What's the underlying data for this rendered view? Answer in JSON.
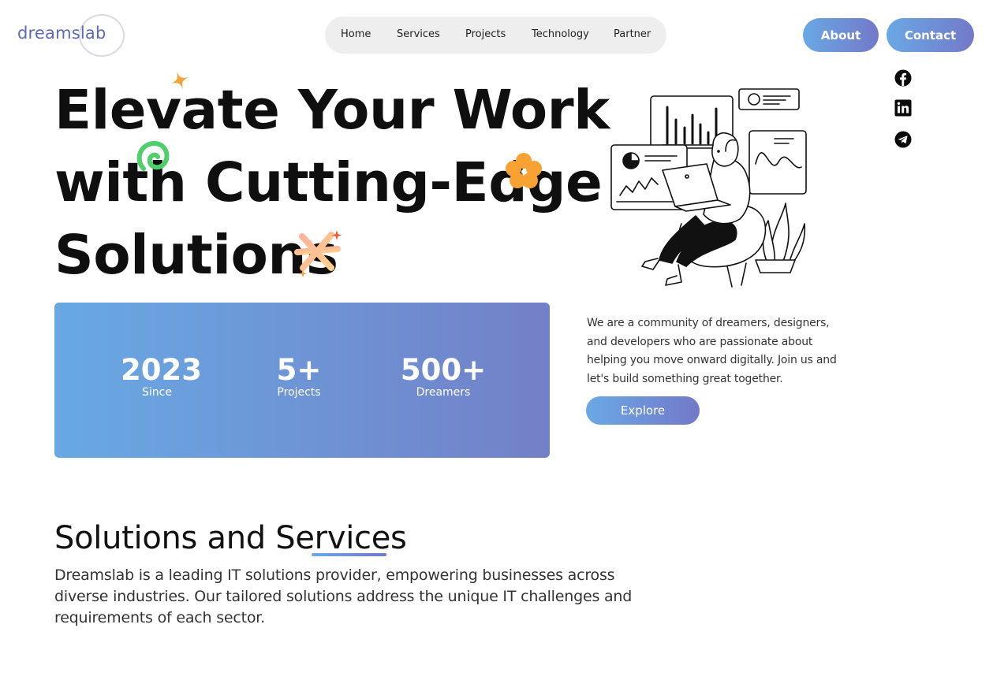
{
  "brand": {
    "logo_text": "dreamslab"
  },
  "nav": {
    "items": [
      {
        "label": "Home"
      },
      {
        "label": "Services"
      },
      {
        "label": "Projects"
      },
      {
        "label": "Technology"
      },
      {
        "label": "Partner"
      }
    ]
  },
  "header_buttons": {
    "about": "About",
    "contact": "Contact"
  },
  "social": {
    "icons": [
      "facebook-icon",
      "linkedin-icon",
      "telegram-icon"
    ]
  },
  "hero": {
    "line1": "Elevate Your Work",
    "line2": "with Cutting-Edge",
    "line3": "Solutions"
  },
  "stats": [
    {
      "value": "2023",
      "label": "Since"
    },
    {
      "value": "5+",
      "label": "Projects"
    },
    {
      "value": "500+",
      "label": "Dreamers"
    }
  ],
  "about": {
    "text": "We are a community of dreamers, designers, and developers who are passionate about helping you move onward digitally. Join us and let's build something great together.",
    "button": "Explore"
  },
  "services": {
    "title": "Solutions and Services",
    "description": "Dreamslab is a leading IT solutions provider, empowering businesses across diverse industries. Our tailored solutions address the unique IT challenges and requirements of each sector."
  },
  "colors": {
    "accent_start": "#6aa8e4",
    "accent_end": "#7379c8"
  }
}
